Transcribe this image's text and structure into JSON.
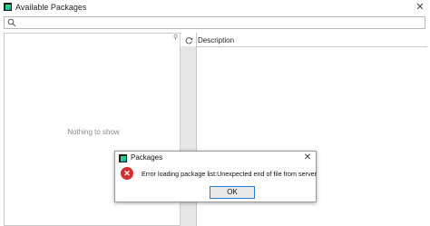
{
  "window": {
    "title": "Available Packages",
    "close_glyph": "✕"
  },
  "search": {
    "value": "",
    "placeholder": ""
  },
  "packages_list": {
    "empty_text": "Nothing to show"
  },
  "description": {
    "label": "Description"
  },
  "dialog": {
    "title": "Packages",
    "close_glyph": "✕",
    "icon_glyph": "✕",
    "message": "Error loading package list:Unexpected end of file from server",
    "ok_label": "OK"
  },
  "icons": {
    "app": "pycharm-icon",
    "search": "search-icon",
    "refresh": "refresh-icon",
    "pin": "pin-icon",
    "error": "error-icon"
  },
  "colors": {
    "error_red": "#d32f2f",
    "focus_blue": "#2a7ad6"
  }
}
